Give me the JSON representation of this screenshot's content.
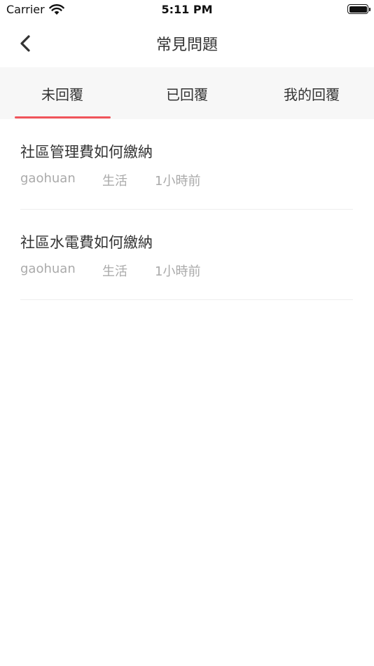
{
  "status_bar": {
    "carrier": "Carrier",
    "time": "5:11 PM"
  },
  "nav": {
    "title": "常見問題",
    "back_icon": "chevron-left-icon"
  },
  "tabs": [
    {
      "label": "未回覆",
      "active": true
    },
    {
      "label": "已回覆",
      "active": false
    },
    {
      "label": "我的回覆",
      "active": false
    }
  ],
  "colors": {
    "accent": "#f0545b",
    "tab_bar_bg": "#f7f7f7",
    "meta_text": "#aaaaaa"
  },
  "questions": [
    {
      "title": "社區管理費如何繳納",
      "author": "gaohuan",
      "category": "生活",
      "time": "1小時前"
    },
    {
      "title": "社區水電費如何繳納",
      "author": "gaohuan",
      "category": "生活",
      "time": "1小時前"
    }
  ]
}
